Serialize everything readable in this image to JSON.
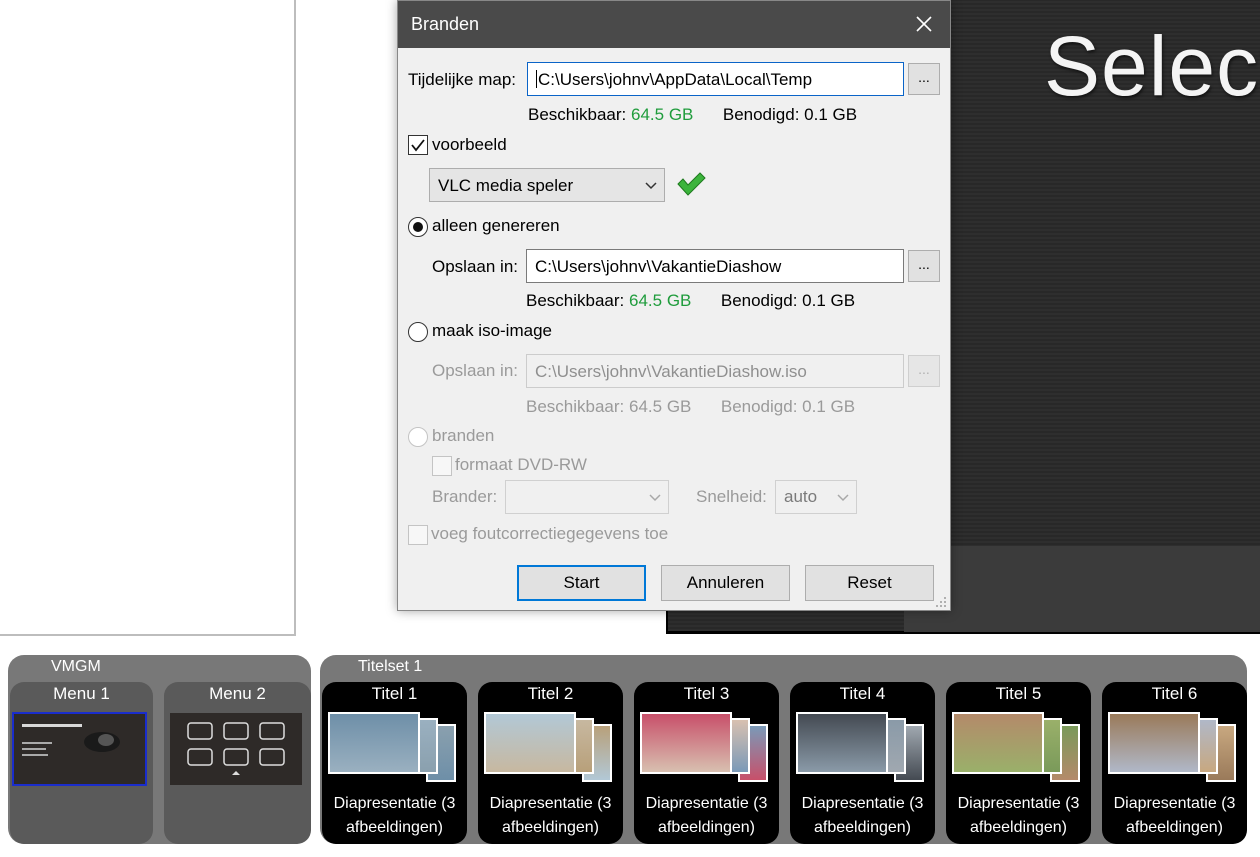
{
  "dialog": {
    "title": "Branden",
    "temp_dir_label": "Tijdelijke map:",
    "temp_dir_value": "C:\\Users\\johnv\\AppData\\Local\\Temp",
    "browse_label": "...",
    "available_label": "Beschikbaar:",
    "available_value": "64.5 GB",
    "needed_label": "Benodigd:",
    "needed_value": "0.1 GB",
    "preview_checkbox_label": "voorbeeld",
    "preview_checked": true,
    "player_select": "VLC media speler",
    "generate_only_label": "alleen genereren",
    "save_in_label": "Opslaan in:",
    "generate_path": "C:\\Users\\johnv\\VakantieDiashow",
    "iso_label": "maak iso-image",
    "iso_path": "C:\\Users\\johnv\\VakantieDiashow.iso",
    "burn_label": "branden",
    "format_dvdrw_label": "formaat DVD-RW",
    "burner_label": "Brander:",
    "burner_value": "",
    "speed_label": "Snelheid:",
    "speed_value": "auto",
    "error_correction_label": "voeg foutcorrectiegegevens toe",
    "buttons": {
      "start": "Start",
      "cancel": "Annuleren",
      "reset": "Reset"
    },
    "colors": {
      "titlebar": "#4a4a4a",
      "available": "#1f9c3c",
      "accent": "#0078d7"
    }
  },
  "preview": {
    "text": "Select"
  },
  "strip": {
    "vmgm": {
      "label": "VMGM",
      "menus": [
        {
          "label": "Menu 1",
          "selected": true
        },
        {
          "label": "Menu 2",
          "selected": false
        }
      ]
    },
    "titleset": {
      "label": "Titelset 1",
      "titles": [
        {
          "label": "Titel 1",
          "caption1": "Diapresentatie (3",
          "caption2": "afbeeldingen)"
        },
        {
          "label": "Titel 2",
          "caption1": "Diapresentatie (3",
          "caption2": "afbeeldingen)"
        },
        {
          "label": "Titel 3",
          "caption1": "Diapresentatie (3",
          "caption2": "afbeeldingen)"
        },
        {
          "label": "Titel 4",
          "caption1": "Diapresentatie (3",
          "caption2": "afbeeldingen)"
        },
        {
          "label": "Titel 5",
          "caption1": "Diapresentatie (3",
          "caption2": "afbeeldingen)"
        },
        {
          "label": "Titel 6",
          "caption1": "Diapresentatie (3",
          "caption2": "afbeeldingen)"
        }
      ]
    }
  }
}
